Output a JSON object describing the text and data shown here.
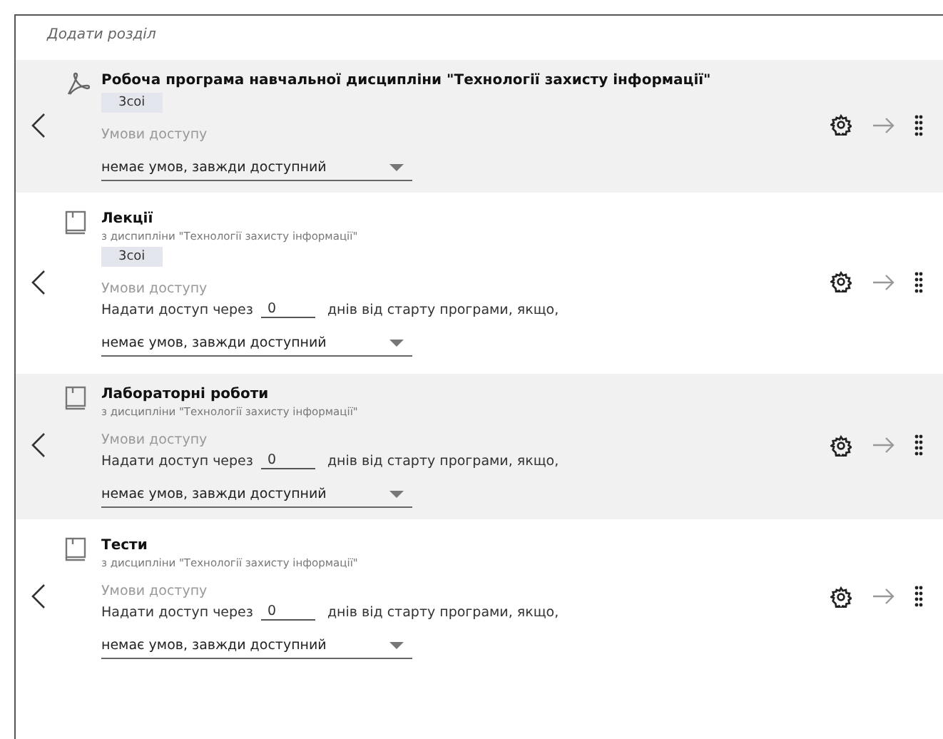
{
  "add_section": "Додати розділ",
  "sections": [
    {
      "kind": "pdf",
      "shaded": true,
      "title": "Робоча програма навчальної дисципліни \"Технології захисту інформації\"",
      "tag": "3соі",
      "access_label": "Умови доступу",
      "condition": "немає умов, завжди доступний"
    },
    {
      "kind": "book",
      "shaded": false,
      "title": "Лекції",
      "subtitle": "з диспипліни \"Технології захисту інформації\"",
      "tag": "3соі",
      "access_label": "Умови доступу",
      "delay": {
        "prefix": "Надати доступ через",
        "value": "0",
        "suffix": "днів від старту програми, якщо,"
      },
      "condition": "немає умов, завжди доступний"
    },
    {
      "kind": "book",
      "shaded": true,
      "title": "Лабораторні роботи",
      "subtitle": "з дисципліни \"Технології захисту інформації\"",
      "access_label": "Умови доступу",
      "delay": {
        "prefix": "Надати доступ через",
        "value": "0",
        "suffix": "днів від старту програми, якщо,"
      },
      "condition": "немає умов, завжди доступний"
    },
    {
      "kind": "book",
      "shaded": false,
      "title": "Тести",
      "subtitle": "з дисципліни \"Технології захисту інформації\"",
      "access_label": "Умови доступу",
      "delay": {
        "prefix": "Надати доступ через",
        "value": "0",
        "suffix": "днів від старту програми, якщо,"
      },
      "condition": "немає умов, завжди доступний"
    }
  ]
}
